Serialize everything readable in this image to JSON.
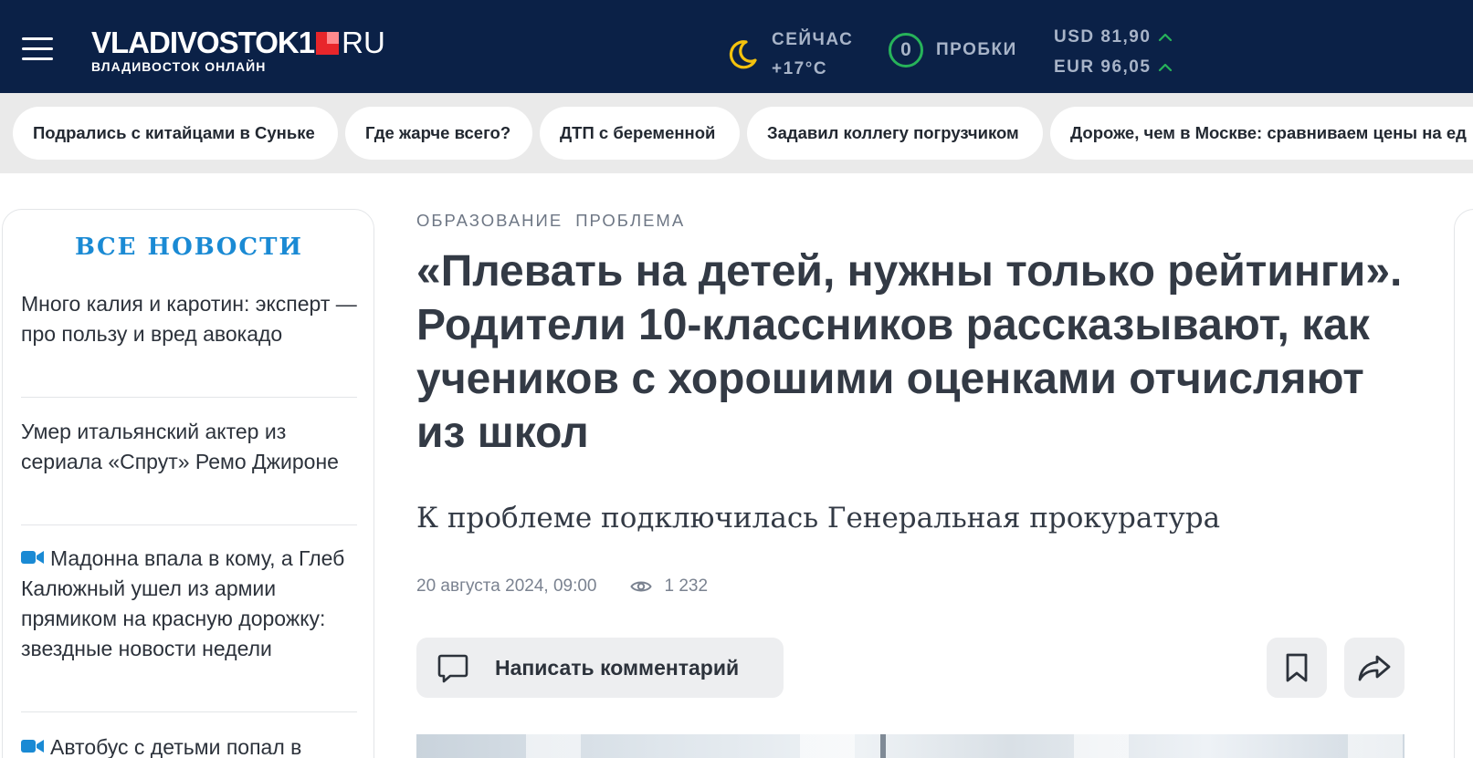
{
  "header": {
    "logo_text": "VLADIVOSTOK1",
    "logo_domain": "RU",
    "logo_sub": "ВЛАДИВОСТОК ОНЛАЙН",
    "weather": {
      "label": "СЕЙЧАС",
      "temp": "+17°C",
      "icon": "moon-icon"
    },
    "traffic": {
      "score": "0",
      "label": "ПРОБКИ"
    },
    "rates": [
      {
        "label": "USD 81,90",
        "trend": "up"
      },
      {
        "label": "EUR 96,05",
        "trend": "up"
      }
    ],
    "colors": {
      "background": "#0b2147",
      "accent": "#e8262b",
      "positive": "#27b35a",
      "moon": "#f4c20d"
    }
  },
  "topics": [
    "Подрались с китайцами в Суньке",
    "Где жарче всего?",
    "ДТП с беременной",
    "Задавил коллегу погрузчиком",
    "Дороже, чем в Москве: сравниваем цены на ед"
  ],
  "sidebar": {
    "title": "ВСЕ НОВОСТИ",
    "items": [
      {
        "text": "Много калия и каротин: эксперт — про пользу и вред авокадо",
        "video": false
      },
      {
        "text": "Умер итальянский актер из сериала «Спрут» Ремо Джироне",
        "video": false
      },
      {
        "text": "Мадонна впала в кому, а Глеб Калюжный ушел из армии прямиком на красную дорожку: звездные новости недели",
        "video": true
      },
      {
        "text": "Автобус с детьми попал в",
        "video": true
      }
    ]
  },
  "article": {
    "rubrics": [
      "ОБРАЗОВАНИЕ",
      "ПРОБЛЕМА"
    ],
    "headline": "«Плевать на детей, нужны только рейтинги». Родители 10-классников рассказывают, как учеников с хорошими оценками отчисляют из школ",
    "lead": "К проблеме подключилась Генеральная прокуратура",
    "date": "20 августа 2024, 09:00",
    "views": "1 232",
    "comment_label": "Написать комментарий"
  }
}
